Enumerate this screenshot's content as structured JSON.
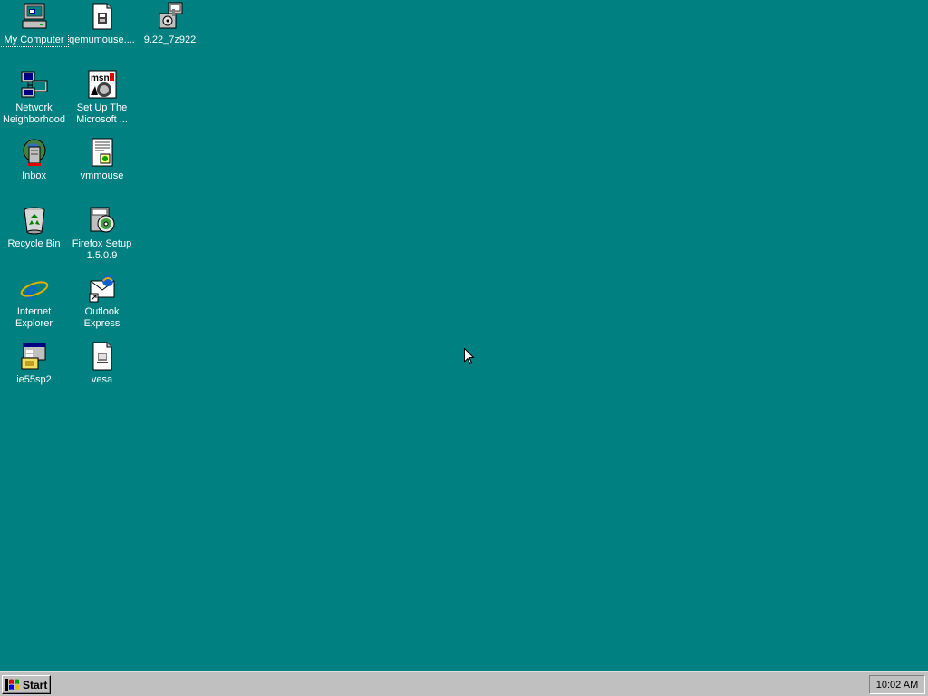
{
  "desktop": {
    "background_color": "#008080",
    "icons": [
      {
        "label": "My Computer",
        "icon": "my-computer-icon",
        "selected": true
      },
      {
        "label": "qemumouse....",
        "icon": "setup-file-icon",
        "selected": false
      },
      {
        "label": "9.22_7z922",
        "icon": "installer-package-icon",
        "selected": false
      },
      {
        "label": "Network\nNeighborhood",
        "icon": "network-neighborhood-icon",
        "selected": false
      },
      {
        "label": "Set Up The\nMicrosoft ...",
        "icon": "msn-setup-icon",
        "selected": false
      },
      {
        "label": "Inbox",
        "icon": "inbox-icon",
        "selected": false
      },
      {
        "label": "vmmouse",
        "icon": "setup-info-file-icon",
        "selected": false
      },
      {
        "label": "Recycle Bin",
        "icon": "recycle-bin-icon",
        "selected": false
      },
      {
        "label": "Firefox Setup\n1.5.0.9",
        "icon": "firefox-setup-icon",
        "selected": false
      },
      {
        "label": "Internet\nExplorer",
        "icon": "internet-explorer-icon",
        "selected": false
      },
      {
        "label": "Outlook\nExpress",
        "icon": "outlook-express-icon",
        "selected": false
      },
      {
        "label": "ie55sp2",
        "icon": "ie-setup-icon",
        "selected": false
      },
      {
        "label": "vesa",
        "icon": "document-icon",
        "selected": false
      }
    ]
  },
  "taskbar": {
    "start_label": "Start",
    "clock": "10:02 AM"
  }
}
